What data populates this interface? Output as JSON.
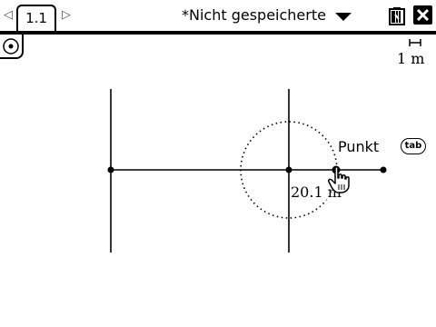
{
  "header": {
    "nav_left": "◁",
    "nav_right": "▷",
    "page_tab": "1.1",
    "document_title": "*Nicht gespeicherte"
  },
  "window": {
    "battery_icon": "battery-icon",
    "close_icon": "close-icon"
  },
  "canvas": {
    "scale_label": "1 m",
    "point_label": "Punkt",
    "tab_hint": "tab",
    "measurement": "20.1 m"
  },
  "colors": {
    "accent": "#000000",
    "background": "#ffffff"
  }
}
